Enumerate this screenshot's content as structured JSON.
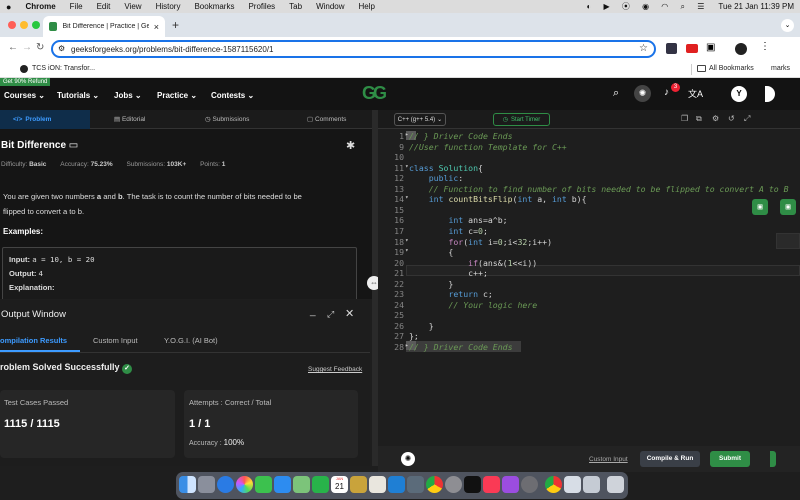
{
  "menubar": {
    "apple": "",
    "app": "Chrome",
    "items": [
      "File",
      "Edit",
      "View",
      "History",
      "Bookmarks",
      "Profiles",
      "Tab",
      "Window",
      "Help"
    ],
    "datetime": "Tue 21 Jan  11:39 PM"
  },
  "tab": {
    "title": "Bit Difference | Practice | Gee",
    "close": "×",
    "new": "+"
  },
  "address": {
    "url": "geeksforgeeks.org/problems/bit-difference-1587115620/1"
  },
  "bookmarks": {
    "item": "TCS iON: Transfor...",
    "all": "All Bookmarks",
    "marks": "marks"
  },
  "gfg": {
    "promo": "Get 90% Refund",
    "nav": [
      "Courses",
      "Tutorials",
      "Jobs",
      "Practice",
      "Contests"
    ],
    "logo": "GG",
    "notif_count": "3",
    "avatar": "Y"
  },
  "left_tabs": [
    "Problem",
    "Editorial",
    "Submissions",
    "Comments"
  ],
  "problem": {
    "title": "Bit Difference",
    "difficulty_label": "Difficulty:",
    "difficulty": "Basic",
    "accuracy_label": "Accuracy:",
    "accuracy": "75.23%",
    "submissions_label": "Submissions:",
    "submissions": "103K+",
    "points_label": "Points:",
    "points": "1",
    "desc1": "You are given two numbers ",
    "a": "a",
    "and": " and ",
    "b": "b",
    "desc2": ". The task is to count the number of bits needed to be",
    "desc3": "flipped to convert a to b.",
    "examples": "Examples:",
    "input_label": "Input:",
    "input_val": "a = 10, b = 20",
    "output_label": "Output:",
    "output_val": "4",
    "explanation_label": "Explanation:"
  },
  "output": {
    "title": "Output Window",
    "tabs": [
      "ompilation Results",
      "Custom Input",
      "Y.O.G.I. (AI Bot)"
    ],
    "status": "roblem Solved Successfully",
    "suggest": "Suggest Feedback",
    "card1_label": "Test Cases Passed",
    "card1_value": "1115 / 1115",
    "card2_label": "Attempts : Correct / Total",
    "card2_value": "1 / 1",
    "accuracy_label": "Accuracy :",
    "accuracy_value": "100%"
  },
  "editor": {
    "language": "C++ (g++ 5.4)",
    "timer": "Start Timer"
  },
  "code_lines": [
    {
      "n": "1",
      "arrow": "▸",
      "text": "// } Driver Code Ends"
    },
    {
      "n": "9",
      "text": "//User function Template for C++"
    },
    {
      "n": "10",
      "text": ""
    },
    {
      "n": "11",
      "arrow": "▾",
      "text": "class Solution{"
    },
    {
      "n": "12",
      "text": "    public:"
    },
    {
      "n": "13",
      "text": "    // Function to find number of bits needed to be flipped to convert A to B"
    },
    {
      "n": "14",
      "arrow": "▾",
      "text": "    int countBitsFlip(int a, int b){"
    },
    {
      "n": "15",
      "text": ""
    },
    {
      "n": "16",
      "text": "        int ans=a^b;"
    },
    {
      "n": "17",
      "text": "        int c=0;"
    },
    {
      "n": "18",
      "arrow": "▾",
      "text": "        for(int i=0;i<32;i++)"
    },
    {
      "n": "19",
      "arrow": "▾",
      "text": "        {"
    },
    {
      "n": "20",
      "text": "            if(ans&(1<<i))"
    },
    {
      "n": "21",
      "text": "            c++;"
    },
    {
      "n": "22",
      "text": "        }"
    },
    {
      "n": "23",
      "text": "        return c;"
    },
    {
      "n": "24",
      "text": "        // Your logic here"
    },
    {
      "n": "25",
      "text": ""
    },
    {
      "n": "26",
      "text": "    }"
    },
    {
      "n": "27",
      "text": "};"
    },
    {
      "n": "28",
      "arrow": "▸",
      "text": "// } Driver Code Ends"
    }
  ],
  "bottom": {
    "custom_input": "Custom Input",
    "compile": "Compile & Run",
    "submit": "Submit"
  },
  "dock": {
    "calendar_month": "JAN",
    "calendar_day": "21"
  }
}
